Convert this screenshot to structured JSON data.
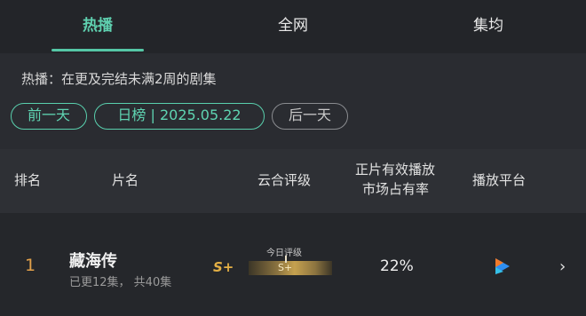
{
  "tabs": [
    {
      "label": "热播",
      "active": true
    },
    {
      "label": "全网",
      "active": false
    },
    {
      "label": "集均",
      "active": false
    }
  ],
  "info": {
    "description": "热播：在更及完结未满2周的剧集",
    "prev_day": "前一天",
    "date_label": "日榜 | 2025.05.22",
    "next_day": "后一天"
  },
  "table": {
    "headers": {
      "rank": "排名",
      "title": "片名",
      "rating": "云合评级",
      "share_line1": "正片有效播放",
      "share_line2": "市场占有率",
      "platform": "播放平台"
    },
    "rows": [
      {
        "rank": "1",
        "title": "藏海传",
        "episodes": "已更12集， 共40集",
        "grade": "S+",
        "today_label": "今日评级",
        "today_grade": "S+",
        "share": "22%",
        "platform_icon": "youku-icon"
      }
    ]
  },
  "colors": {
    "accent": "#55c7a6",
    "rank": "#e2a04a",
    "grade": "#e4b045"
  }
}
